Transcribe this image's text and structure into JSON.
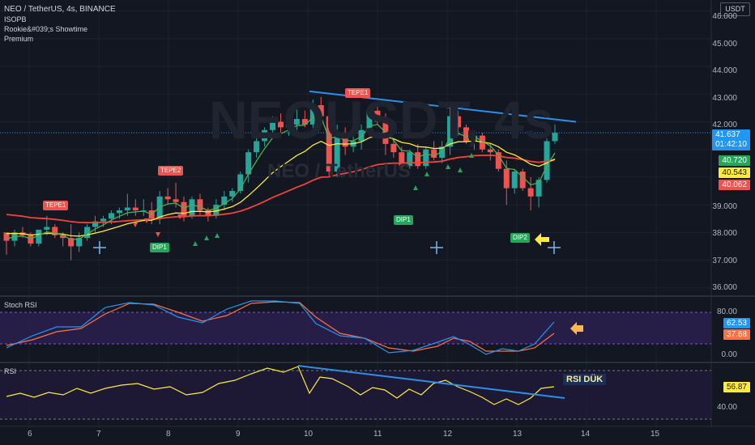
{
  "header": {
    "symbol_line": "NEO / TetherUS, 4s, BINANCE",
    "indicators": [
      "ISOPB",
      "Rookie&#039;s Showtime",
      "Premium"
    ],
    "currency": "USDT"
  },
  "watermark": {
    "big": "NEOUSDT, 4s",
    "small": "NEO / TetherUS"
  },
  "price_axis": {
    "ticks": [
      "46.000",
      "45.000",
      "44.000",
      "43.000",
      "42.000",
      "39.000",
      "38.000",
      "37.000",
      "36.000"
    ]
  },
  "price_tags": [
    {
      "label": "41.637",
      "sub": "01:42:10",
      "color": "#2196f3"
    },
    {
      "label": "40.720",
      "color": "#26a65b"
    },
    {
      "label": "40.543",
      "color": "#ffeb3b"
    },
    {
      "label": "40.062",
      "color": "#ef5350"
    }
  ],
  "signals": {
    "tepe": [
      "TEPE1",
      "TEPE2",
      "TEPE1"
    ],
    "dip": [
      "DIP1",
      "DIP1",
      "DIP2"
    ]
  },
  "stoch_rsi": {
    "title": "Stoch RSI",
    "ticks": [
      "80.00",
      "0.00"
    ],
    "tags": [
      {
        "label": "62.53",
        "color": "#2196f3"
      },
      {
        "label": "37.68",
        "color": "#ff7043"
      }
    ]
  },
  "rsi": {
    "title": "RSI",
    "ticks": [
      "40.00"
    ],
    "tags": [
      {
        "label": "56.87",
        "color": "#ffeb3b"
      }
    ],
    "note": "RSI DÜK"
  },
  "time_axis": [
    "6",
    "7",
    "8",
    "9",
    "10",
    "11",
    "12",
    "13",
    "14",
    "15"
  ],
  "colors": {
    "bg": "#131722",
    "up": "#26a69a",
    "down": "#ef5350",
    "trend": "#2e8fe8"
  },
  "chart_data": {
    "type": "candlestick",
    "title": "NEO / TetherUS, 4s, BINANCE",
    "y_ticks": [
      46,
      45,
      44,
      43,
      42,
      39,
      38,
      37,
      36
    ],
    "ylim": [
      35.7,
      46.4
    ],
    "x_ticks": [
      "6",
      "7",
      "8",
      "9",
      "10",
      "11",
      "12",
      "13",
      "14",
      "15"
    ],
    "candles": [
      [
        38.0,
        38.0,
        37.2,
        37.7
      ],
      [
        37.7,
        38.1,
        37.5,
        38.0
      ],
      [
        38.0,
        38.2,
        37.8,
        37.9
      ],
      [
        37.9,
        38.0,
        37.5,
        37.6
      ],
      [
        37.6,
        38.1,
        37.5,
        38.1
      ],
      [
        38.1,
        38.6,
        37.9,
        38.2
      ],
      [
        38.2,
        38.3,
        37.8,
        37.9
      ],
      [
        37.9,
        38.0,
        37.5,
        37.8
      ],
      [
        37.8,
        38.3,
        37.0,
        37.5
      ],
      [
        37.5,
        38.0,
        37.3,
        37.8
      ],
      [
        37.8,
        38.3,
        37.7,
        38.2
      ],
      [
        38.2,
        38.6,
        38.0,
        38.4
      ],
      [
        38.4,
        38.6,
        38.2,
        38.5
      ],
      [
        38.5,
        38.8,
        38.3,
        38.7
      ],
      [
        38.7,
        38.9,
        38.5,
        38.8
      ],
      [
        38.8,
        39.4,
        38.6,
        38.9
      ],
      [
        38.9,
        39.2,
        38.6,
        38.8
      ],
      [
        38.8,
        39.2,
        38.6,
        38.8
      ],
      [
        38.8,
        39.1,
        38.3,
        38.5
      ],
      [
        38.5,
        39.5,
        38.3,
        39.3
      ],
      [
        39.3,
        39.6,
        39.0,
        39.2
      ],
      [
        39.2,
        39.8,
        38.9,
        39.1
      ],
      [
        39.1,
        39.3,
        38.4,
        38.6
      ],
      [
        38.6,
        39.3,
        38.5,
        39.2
      ],
      [
        39.2,
        39.4,
        38.6,
        38.8
      ],
      [
        38.8,
        38.9,
        38.4,
        38.6
      ],
      [
        38.6,
        39.2,
        38.5,
        39.0
      ],
      [
        39.0,
        39.5,
        38.8,
        39.3
      ],
      [
        39.3,
        39.6,
        39.1,
        39.5
      ],
      [
        39.5,
        40.2,
        39.4,
        40.1
      ],
      [
        40.1,
        41.0,
        39.8,
        40.9
      ],
      [
        40.9,
        41.5,
        40.7,
        41.3
      ],
      [
        41.3,
        41.8,
        41.1,
        41.7
      ],
      [
        41.7,
        42.2,
        41.4,
        42.0
      ],
      [
        42.0,
        42.3,
        41.6,
        41.8
      ],
      [
        41.8,
        42.1,
        41.5,
        41.9
      ],
      [
        41.9,
        42.5,
        41.7,
        42.1
      ],
      [
        42.1,
        42.4,
        41.8,
        41.9
      ],
      [
        41.9,
        42.8,
        41.7,
        42.6
      ],
      [
        42.6,
        42.9,
        42.0,
        42.2
      ],
      [
        42.2,
        42.4,
        40.0,
        40.2
      ],
      [
        40.2,
        41.9,
        40.0,
        41.6
      ],
      [
        41.6,
        41.8,
        40.8,
        41.1
      ],
      [
        41.1,
        41.6,
        40.9,
        41.3
      ],
      [
        41.3,
        41.9,
        41.0,
        41.7
      ],
      [
        41.7,
        42.6,
        41.5,
        42.4
      ],
      [
        42.4,
        42.7,
        41.9,
        42.0
      ],
      [
        42.0,
        42.3,
        40.8,
        41.2
      ],
      [
        41.2,
        41.4,
        40.7,
        40.9
      ],
      [
        40.9,
        41.1,
        40.3,
        40.4
      ],
      [
        40.4,
        41.0,
        40.3,
        40.9
      ],
      [
        40.9,
        41.2,
        40.3,
        40.4
      ],
      [
        40.4,
        41.1,
        40.3,
        41.0
      ],
      [
        41.0,
        41.3,
        40.6,
        40.7
      ],
      [
        40.7,
        41.3,
        40.5,
        41.1
      ],
      [
        41.1,
        42.5,
        40.8,
        42.2
      ],
      [
        42.2,
        42.4,
        41.5,
        41.8
      ],
      [
        41.8,
        41.9,
        41.2,
        41.3
      ],
      [
        41.3,
        41.6,
        41.0,
        41.5
      ],
      [
        41.5,
        41.6,
        40.9,
        41.0
      ],
      [
        41.0,
        41.2,
        40.6,
        40.9
      ],
      [
        40.9,
        41.0,
        40.2,
        40.3
      ],
      [
        40.3,
        40.6,
        39.0,
        39.6
      ],
      [
        39.6,
        40.3,
        39.4,
        40.2
      ],
      [
        40.2,
        40.3,
        39.5,
        39.6
      ],
      [
        39.6,
        40.0,
        38.8,
        39.3
      ],
      [
        39.3,
        40.0,
        38.9,
        39.9
      ],
      [
        39.9,
        41.4,
        39.8,
        41.3
      ],
      [
        41.3,
        41.9,
        41.2,
        41.6
      ]
    ],
    "stoch_ticks": [
      80,
      0
    ],
    "rsi_ticks": [
      40
    ]
  }
}
